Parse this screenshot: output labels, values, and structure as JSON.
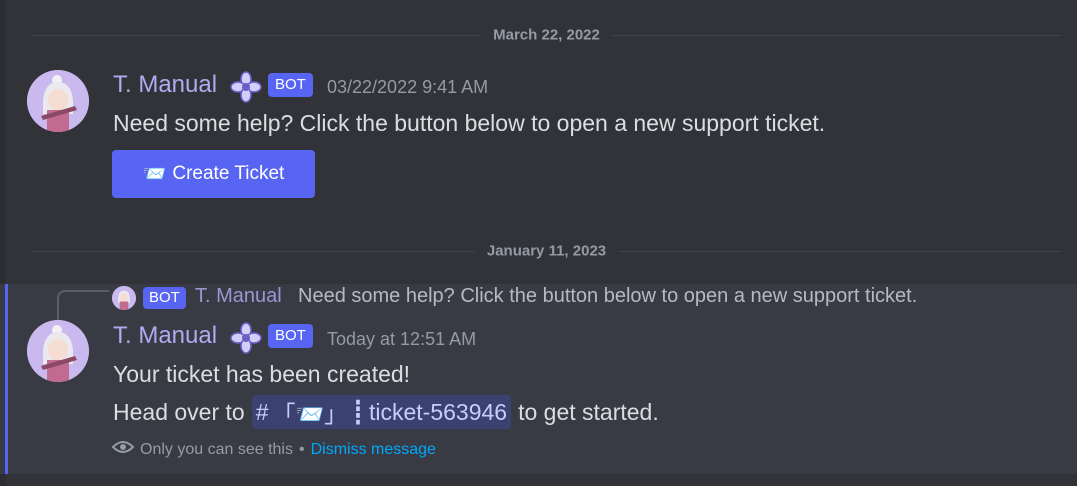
{
  "dividers": [
    {
      "label": "March 22, 2022"
    },
    {
      "label": "January 11, 2023"
    }
  ],
  "messages": [
    {
      "username": "T. Manual",
      "bot_tag": "BOT",
      "timestamp": "03/22/2022 9:41 AM",
      "text": "Need some help? Click the button below to open a new support ticket.",
      "button": {
        "emoji": "📨",
        "label": "Create Ticket"
      }
    },
    {
      "reply": {
        "bot_tag": "BOT",
        "username": "T. Manual",
        "text": "Need some help? Click the button below to open a new support ticket."
      },
      "username": "T. Manual",
      "bot_tag": "BOT",
      "timestamp": "Today at 12:51 AM",
      "line1": "Your ticket has been created!",
      "line2_prefix": "Head over to",
      "channel_mention": {
        "hash": "#",
        "emoji": "「📨」",
        "separator": "┋",
        "name": "ticket-563946"
      },
      "line2_suffix": "to get started.",
      "ephemeral": {
        "note": "Only you can see this",
        "bullet": "•",
        "dismiss": "Dismiss message"
      }
    }
  ],
  "colors": {
    "accent": "#5865f2",
    "username": "#b3a9f0",
    "link": "#00a8fc",
    "background": "#323339"
  }
}
